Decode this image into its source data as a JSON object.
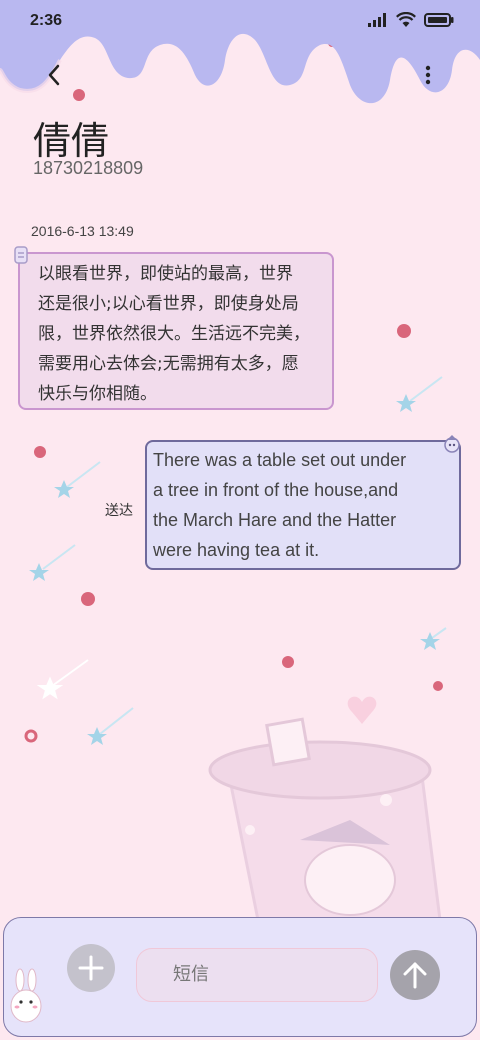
{
  "status_bar": {
    "time": "2:36"
  },
  "header": {
    "back_icon": "chevron-left-icon",
    "more_icon": "more-vertical-icon",
    "contact_name": "倩倩",
    "contact_phone": "18730218809"
  },
  "conversation": {
    "timestamp": "2016-6-13 13:49",
    "messages": [
      {
        "direction": "incoming",
        "lines": [
          "以眼看世界，即使站的最高，世界",
          "还是很小;以心看世界，即使身处局",
          "限，世界依然很大。生活远不完美，",
          "需要用心去体会;无需拥有太多，愿",
          "快乐与你相随。"
        ]
      },
      {
        "direction": "outgoing",
        "status": "送达",
        "lines": [
          "There was a table set out under",
          "a tree in front of the house,and",
          "the March Hare and the Hatter",
          "were having tea at it."
        ]
      }
    ]
  },
  "composer": {
    "add_icon": "plus-icon",
    "input_placeholder": "短信",
    "send_icon": "arrow-up-icon"
  },
  "colors": {
    "background": "#fde8f0",
    "drip": "#b9b8f0",
    "incoming_bubble": "#f2dcec",
    "outgoing_bubble": "#e2e0f8"
  }
}
